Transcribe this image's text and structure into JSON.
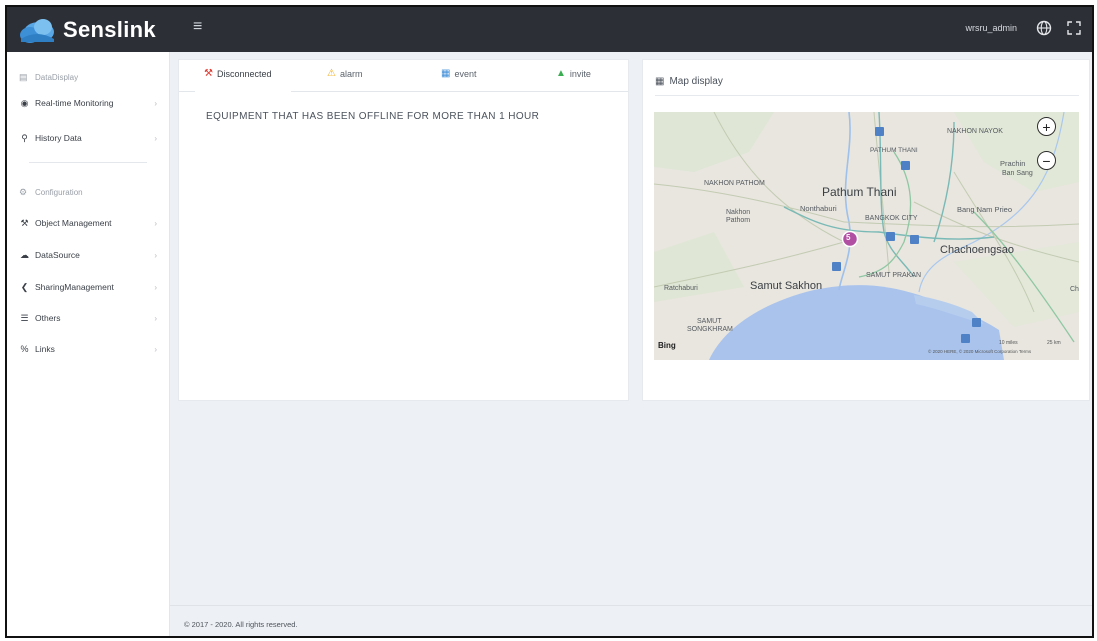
{
  "app": {
    "brand": "Senslink",
    "menu_icon": "hamburger-icon",
    "user": "wrsru_admin",
    "language_icon": "globe-icon",
    "fullscreen_icon": "fullscreen-icon",
    "colors": {
      "topbar": "#2c2f35",
      "background": "#edf0f4"
    }
  },
  "sidebar": {
    "sections": [
      {
        "title": "DataDisplay",
        "icon": "bar-chart-icon"
      },
      {
        "title": "Configuration",
        "icon": "gears-icon"
      }
    ],
    "items": [
      {
        "label": "Real-time Monitoring",
        "icon": "eye-icon"
      },
      {
        "label": "History Data",
        "icon": "search-icon"
      },
      {
        "label": "Object Management",
        "icon": "wrench-icon"
      },
      {
        "label": "DataSource",
        "icon": "cloud-icon"
      },
      {
        "label": "SharingManagement",
        "icon": "share-icon"
      },
      {
        "label": "Others",
        "icon": "sliders-icon"
      },
      {
        "label": "Links",
        "icon": "link-icon"
      }
    ]
  },
  "status_panel": {
    "tabs": [
      {
        "label": "Disconnected",
        "icon": "wrench-icon",
        "color": "#e0352b"
      },
      {
        "label": "alarm",
        "icon": "warning-icon",
        "color": "#f0ad1e"
      },
      {
        "label": "event",
        "icon": "calendar-icon",
        "color": "#3c8dd8"
      },
      {
        "label": "invite",
        "icon": "bell-icon",
        "color": "#3cae52"
      }
    ],
    "active_tab": "Disconnected",
    "heading": "EQUIPMENT THAT HAS BEEN OFFLINE FOR MORE THAN 1 HOUR"
  },
  "map_panel": {
    "title": "Map display",
    "title_icon": "map-icon",
    "zoom_in": "+",
    "zoom_out": "−",
    "cluster_count": "5",
    "attribution_logo": "Bing",
    "copyright": "© 2020 HERE, © 2020 Microsoft Corporation  Terms",
    "scale_left": "10 miles",
    "scale_right": "25 km",
    "places": {
      "pathum_thani_small": "PATHUM THANI",
      "nakhon_nayok": "NAKHON NAYOK",
      "prachin": "Prachin",
      "ban_sang": "Ban Sang",
      "nakhon_pathom_caps": "NAKHON PATHOM",
      "pathum_thani": "Pathum Thani",
      "nakhon": "Nakhon",
      "pathom": "Pathom",
      "nonthaburi": "Nonthaburi",
      "bangkok": "BANGKOK CITY",
      "bang_nam_prieo": "Bang Nam Prieo",
      "chachoengsao": "Chachoengsao",
      "samut_prakan": "SAMUT PRAKAN",
      "ratchaburi": "Ratchaburi",
      "samut_sakhon": "Samut Sakhon",
      "samut": "SAMUT",
      "songkhram": "SONGKHRAM",
      "ch": "Ch"
    }
  },
  "footer": {
    "text": "© 2017 - 2020. All rights reserved."
  }
}
